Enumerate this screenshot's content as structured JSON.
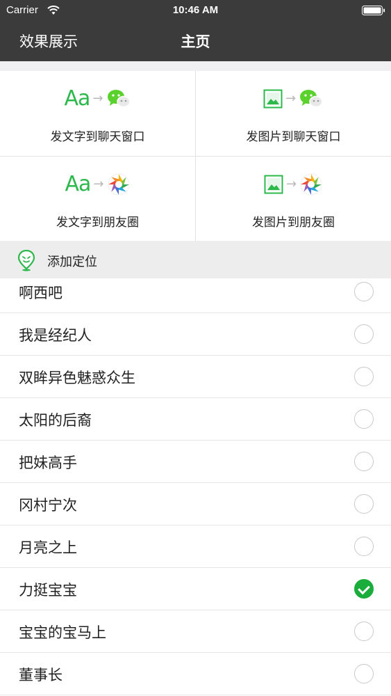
{
  "status_bar": {
    "carrier": "Carrier",
    "time": "10:46 AM"
  },
  "nav": {
    "back_label": "效果展示",
    "title": "主页"
  },
  "accent_color": "#1aad3b",
  "share_options": [
    {
      "source_glyph": "Aa",
      "source": "text",
      "target": "wechat",
      "label": "发文字到聊天窗口"
    },
    {
      "source": "image",
      "target": "wechat",
      "label": "发图片到聊天窗口"
    },
    {
      "source_glyph": "Aa",
      "source": "text",
      "target": "moments",
      "label": "发文字到朋友圈"
    },
    {
      "source": "image",
      "target": "moments",
      "label": "发图片到朋友圈"
    }
  ],
  "location": {
    "label": "添加定位"
  },
  "list_items": [
    {
      "label": "啊西吧",
      "checked": false
    },
    {
      "label": "我是经纪人",
      "checked": false
    },
    {
      "label": "双眸异色魅惑众生",
      "checked": false
    },
    {
      "label": "太阳的后裔",
      "checked": false
    },
    {
      "label": "把妹高手",
      "checked": false
    },
    {
      "label": "冈村宁次",
      "checked": false
    },
    {
      "label": "月亮之上",
      "checked": false
    },
    {
      "label": "力挺宝宝",
      "checked": true
    },
    {
      "label": "宝宝的宝马上",
      "checked": false
    },
    {
      "label": "董事长",
      "checked": false
    }
  ]
}
